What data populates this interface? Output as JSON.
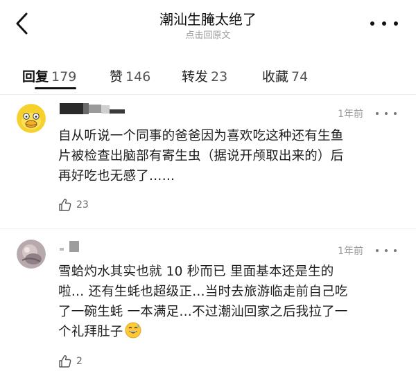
{
  "header": {
    "title": "潮汕生腌太绝了",
    "subtitle": "点击回原文"
  },
  "icons": {
    "back": "back-chevron-icon",
    "more": "more-dots-icon",
    "like": "thumbs-up-icon"
  },
  "tabs": [
    {
      "label": "回复",
      "count": "179",
      "active": true
    },
    {
      "label": "赞",
      "count": "146",
      "active": false
    },
    {
      "label": "转发",
      "count": "23",
      "active": false
    },
    {
      "label": "收藏",
      "count": "74",
      "active": false
    }
  ],
  "comments": [
    {
      "time": "1年前",
      "lines": [
        "自从听说一个同事的爸爸因为喜欢吃这种还有生鱼",
        "片被检查出脑部有寄生虫（据说开颅取出来的）后",
        "再好吃也无感了……"
      ],
      "likes": "23"
    },
    {
      "time": "1年前",
      "lines": [
        "雪蛤灼水其实也就 10 秒而已 里面基本还是生的",
        "啦… 还有生蚝也超级正…当时去旅游临走前自己吃",
        "了一碗生蚝 一本满足…不过潮汕回家之后我拉了一",
        "个礼拜肚子"
      ],
      "likes": "2"
    }
  ]
}
